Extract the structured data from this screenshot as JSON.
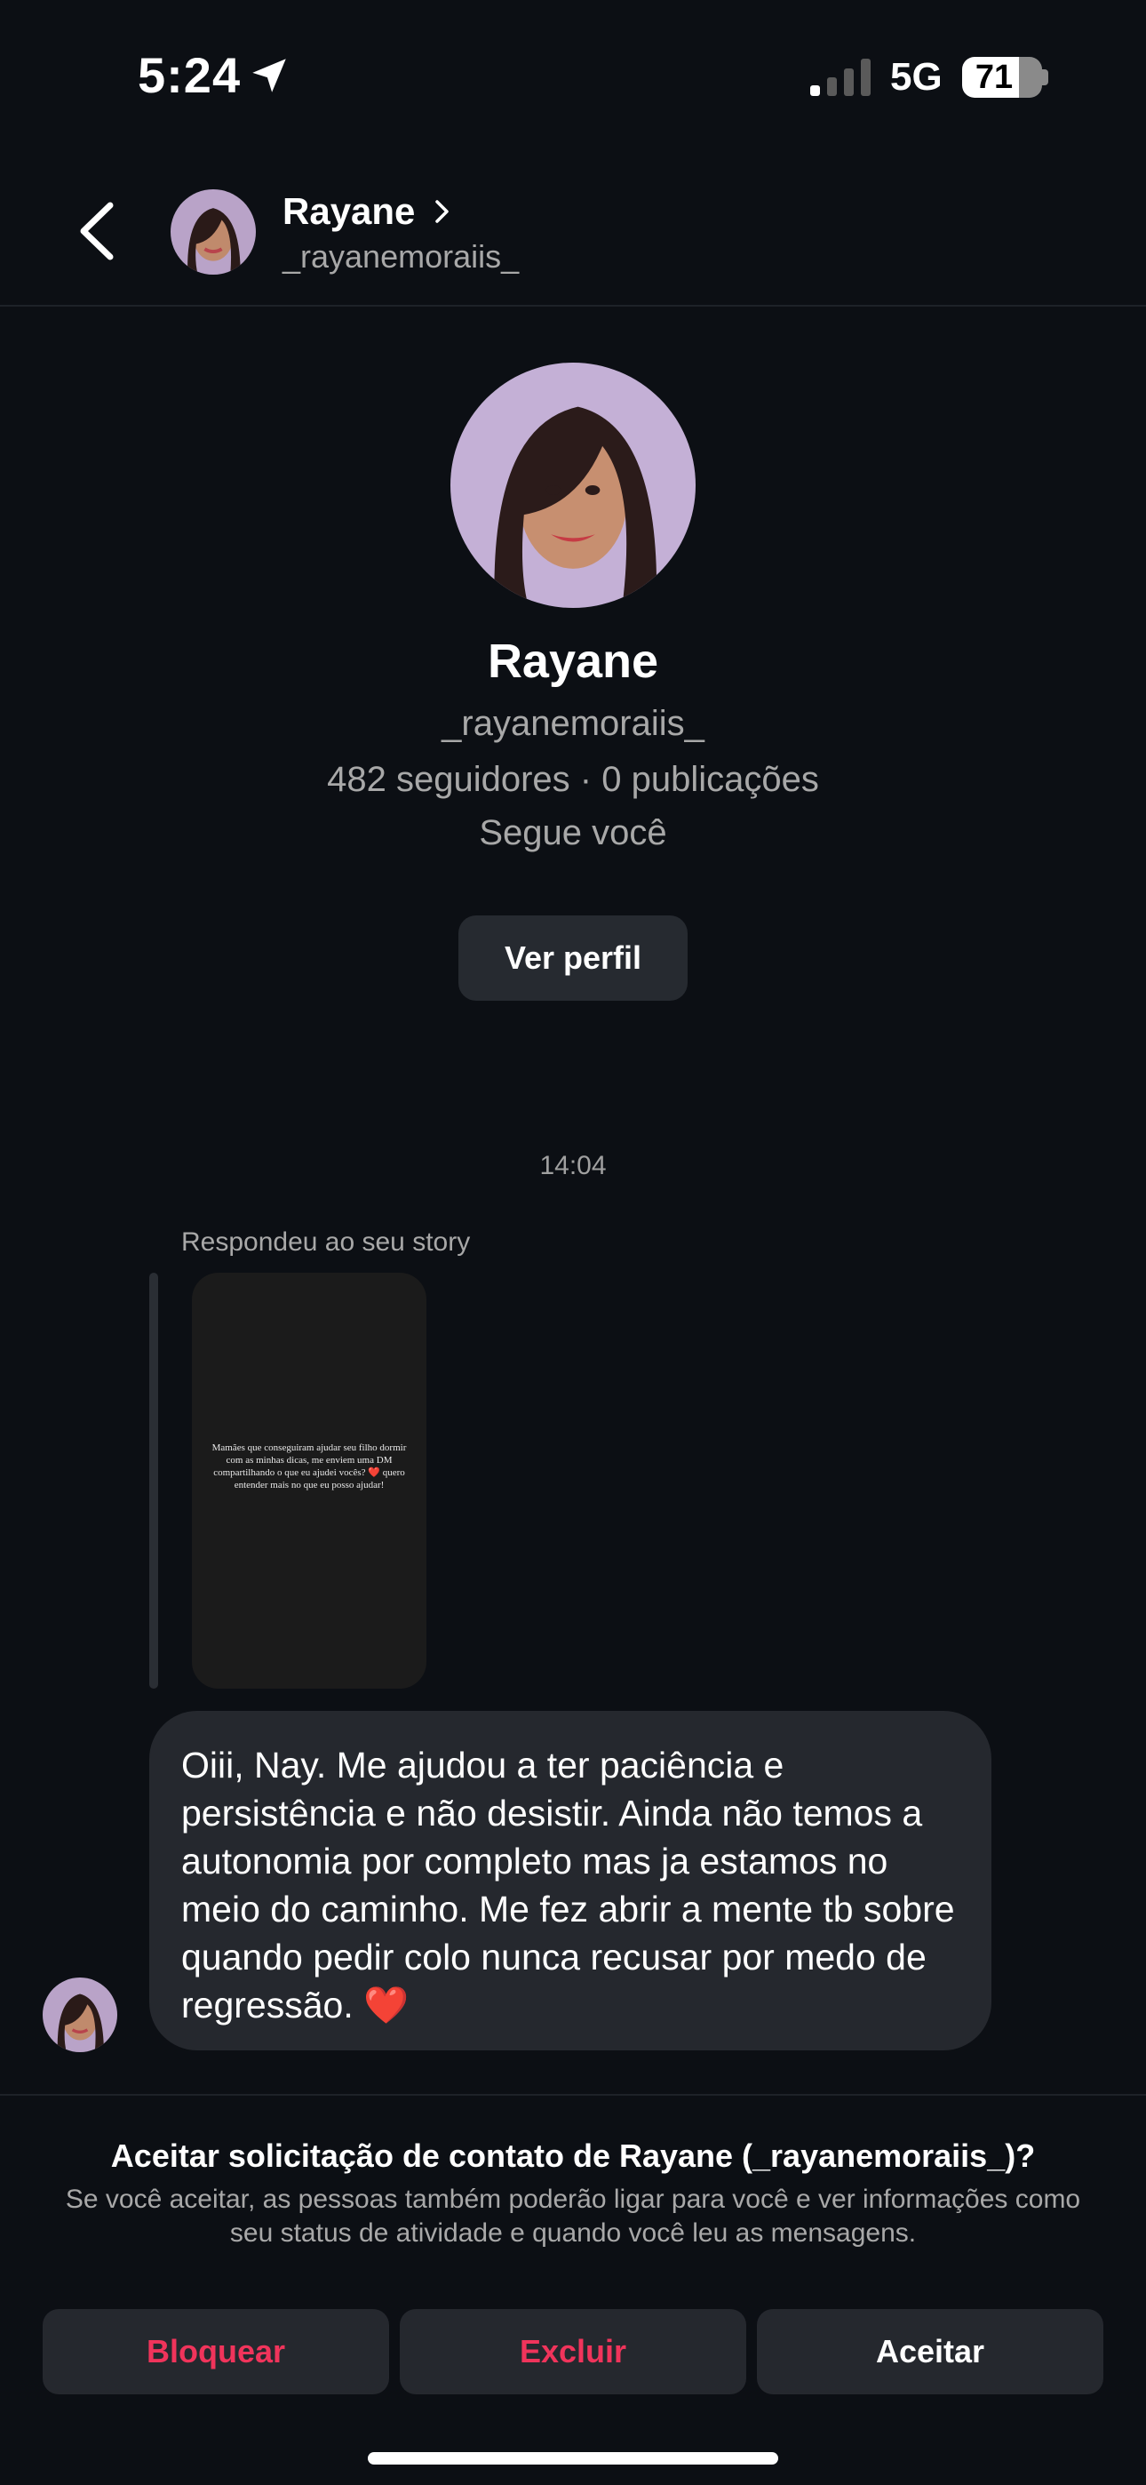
{
  "status_bar": {
    "time": "5:24",
    "network": "5G",
    "battery_level": 71,
    "location_icon": "location-arrow-icon",
    "signal_icon": "cellular-signal-icon"
  },
  "header": {
    "back_icon": "chevron-left-icon",
    "name": "Rayane",
    "handle": "_rayanemoraiis_",
    "chevron_icon": "chevron-right-icon"
  },
  "profile": {
    "name": "Rayane",
    "handle": "_rayanemoraiis_",
    "stats": "482 seguidores · 0 publicações",
    "follow_status": "Segue você",
    "view_profile_label": "Ver perfil"
  },
  "chat": {
    "timestamp": "14:04",
    "story_reply_caption": "Respondeu ao seu story",
    "story_text": "Mamães que conseguiram ajudar seu filho dormir com as minhas dicas, me enviem uma DM compartilhando o que eu ajudei vocês? ❤️ quero entender mais no que eu posso ajudar!",
    "message": "Oiii, Nay. Me ajudou a ter paciência e persistência e não desistir. Ainda não temos a autonomia por completo mas ja estamos no meio do caminho. Me fez abrir a mente tb sobre quando pedir colo nunca recusar por medo de regressão. ❤️"
  },
  "request": {
    "title": "Aceitar solicitação de contato de Rayane (_rayanemoraiis_)?",
    "description": "Se você aceitar, as pessoas também poderão ligar para você e ver informações como seu status de atividade e quando você leu as mensagens.",
    "block_label": "Bloquear",
    "delete_label": "Excluir",
    "accept_label": "Aceitar"
  },
  "colors": {
    "background": "#0c0f14",
    "bubble": "#25282e",
    "danger": "#f0345b",
    "secondary_text": "#a8a8a8"
  }
}
